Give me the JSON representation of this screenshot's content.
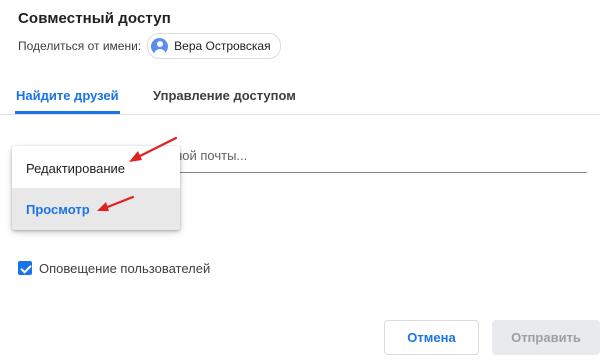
{
  "dialog": {
    "title": "Совместный доступ",
    "share_as_label": "Поделиться от имени:",
    "account_name": "Вера Островская"
  },
  "tabs": [
    {
      "label": "Найдите друзей",
      "active": true
    },
    {
      "label": "Управление доступом",
      "active": false
    }
  ],
  "email_field": {
    "value": "",
    "placeholder_visible_fragment": "са электронной почты...",
    "placeholder": "Введите адреса электронной почты..."
  },
  "permission_dropdown": {
    "options": [
      {
        "label": "Редактирование",
        "highlighted": false
      },
      {
        "label": "Просмотр",
        "highlighted": true
      }
    ]
  },
  "notify": {
    "label": "Оповещение пользователей",
    "checked": true
  },
  "buttons": {
    "cancel_label": "Отмена",
    "send_label": "Отправить"
  },
  "colors": {
    "accent": "#1a73e8",
    "annotation_arrow": "#e02020",
    "disabled_button_bg": "#e8eaed",
    "highlight_bg": "#e8e8e8"
  },
  "icons": {
    "avatar": "avatar-icon",
    "checkbox": "check-icon",
    "annotation": "arrow-annotation-icon"
  }
}
